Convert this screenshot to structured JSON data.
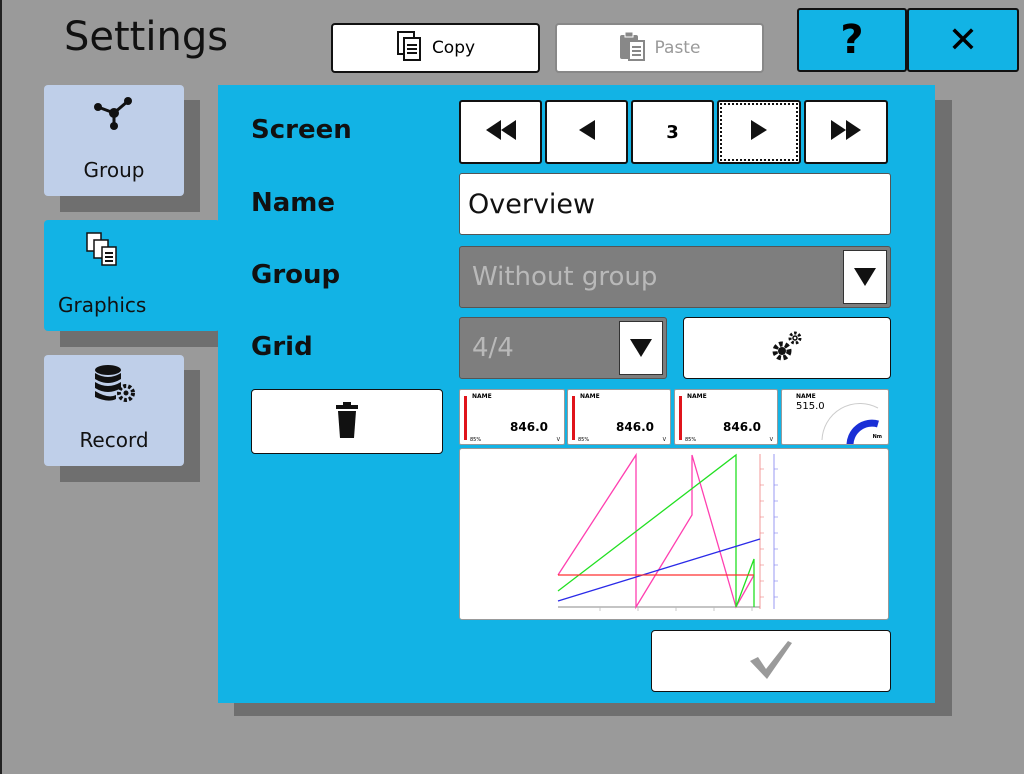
{
  "header": {
    "title": "Settings",
    "copy_label": "Copy",
    "paste_label": "Paste",
    "help_label": "?",
    "close_label": "✕"
  },
  "tabs": [
    {
      "label": "Group",
      "icon": "network-icon"
    },
    {
      "label": "Graphics",
      "icon": "graphics-icon"
    },
    {
      "label": "Record",
      "icon": "database-settings-icon"
    }
  ],
  "form": {
    "screen_label": "Screen",
    "screen_number": "3",
    "name_label": "Name",
    "name_value": "Overview",
    "group_label": "Group",
    "group_value": "Without group",
    "grid_label": "Grid",
    "grid_value": "4/4"
  },
  "preview": {
    "tiles": [
      {
        "name": "NAME",
        "value": "846.0",
        "percent": "85%",
        "unit": "V"
      },
      {
        "name": "NAME",
        "value": "846.0",
        "percent": "85%",
        "unit": "V"
      },
      {
        "name": "NAME",
        "value": "846.0",
        "percent": "85%",
        "unit": "V"
      }
    ],
    "gauge": {
      "name": "NAME",
      "value": "515.0",
      "unit": "Nm"
    }
  },
  "colors": {
    "panel": "#12b3e5",
    "background": "#9a9a9a",
    "tab_inactive": "#bfcfe9"
  }
}
